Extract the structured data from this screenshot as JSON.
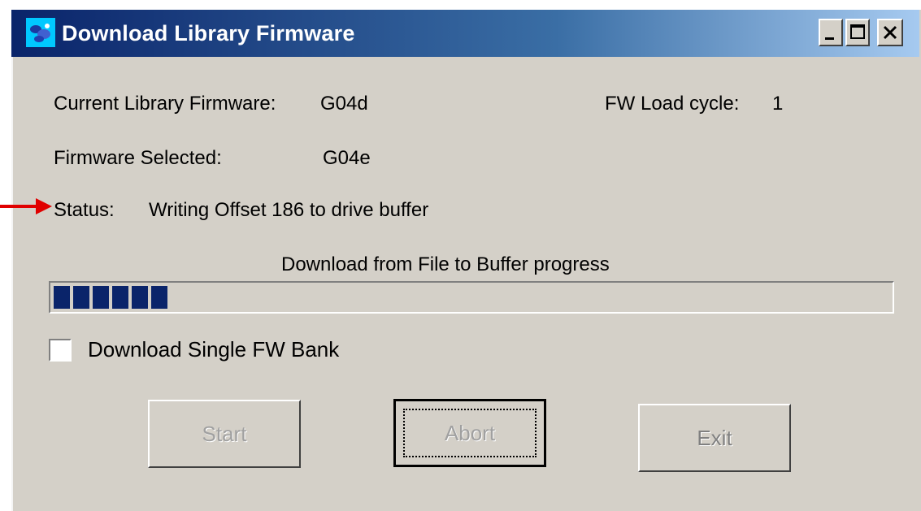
{
  "window": {
    "title": "Download Library Firmware",
    "controls": {
      "minimize": "minimize",
      "maximize": "maximize",
      "close": "close"
    }
  },
  "info": {
    "current_firmware_label": "Current Library Firmware:",
    "current_firmware_value": "G04d",
    "fw_load_cycle_label": "FW Load cycle:",
    "fw_load_cycle_value": "1",
    "firmware_selected_label": "Firmware Selected:",
    "firmware_selected_value": "G04e",
    "status_label": "Status:",
    "status_value": "Writing Offset 186 to drive buffer"
  },
  "progress": {
    "label": "Download from File to Buffer progress",
    "filled_blocks": 6,
    "percent": 15
  },
  "options": {
    "single_bank_label": "Download Single FW Bank",
    "single_bank_checked": false
  },
  "buttons": {
    "start": "Start",
    "abort": "Abort",
    "exit": "Exit"
  },
  "colors": {
    "annotation_arrow": "#e00000",
    "progress_fill": "#0a246a",
    "dialog_bg": "#d4d0c8"
  }
}
